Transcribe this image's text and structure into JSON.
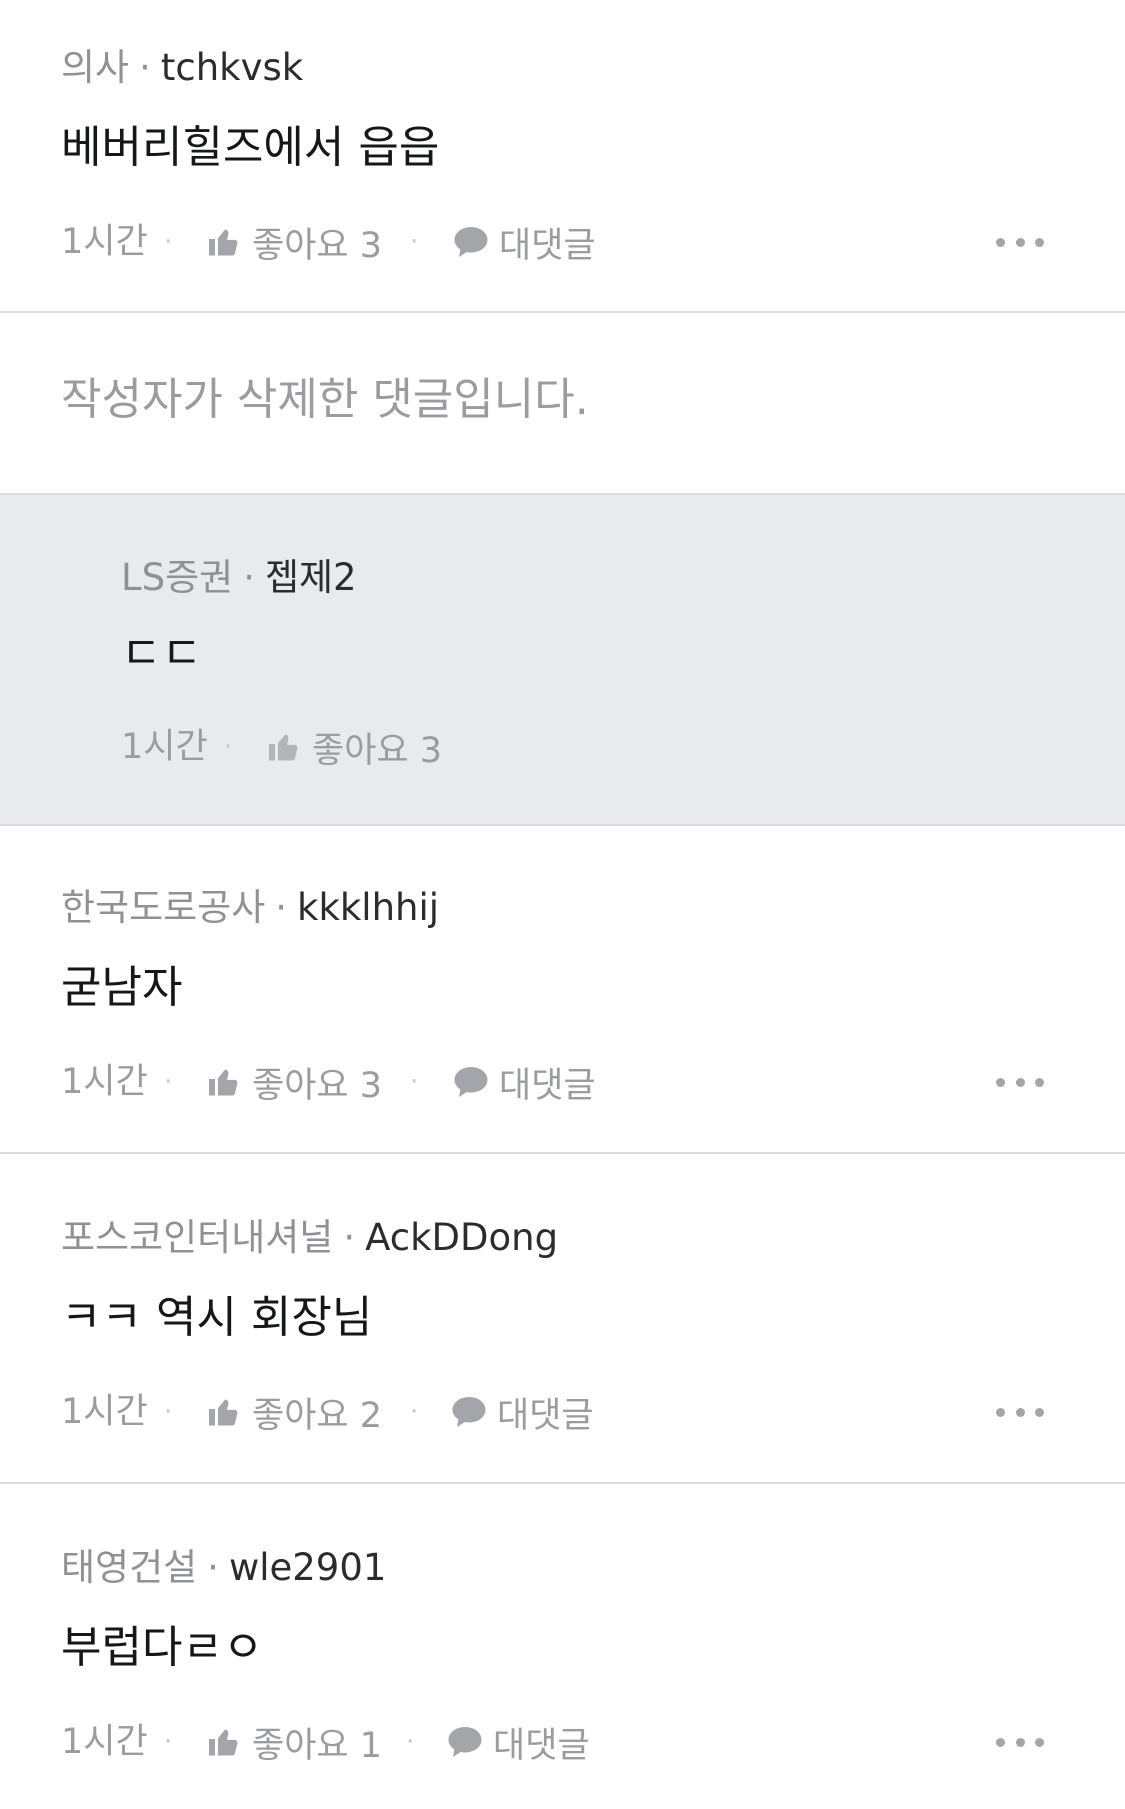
{
  "comments": [
    {
      "company": "의사",
      "nickname": "tchkvsk",
      "text": "베버리힐즈에서 읍읍",
      "time": "1시간",
      "like_label": "좋아요 3",
      "reply_label": "대댓글"
    },
    {
      "deleted_text": "작성자가 삭제한 댓글입니다."
    },
    {
      "company": "LS증권",
      "nickname": "젭제2",
      "text": "ㄷㄷ",
      "time": "1시간",
      "like_label": "좋아요 3"
    },
    {
      "company": "한국도로공사",
      "nickname": "kkklhhij",
      "text": "굳남자",
      "time": "1시간",
      "like_label": "좋아요 3",
      "reply_label": "대댓글"
    },
    {
      "company": "포스코인터내셔널",
      "nickname": "AckDDong",
      "text": "ㅋㅋ 역시 회장님",
      "time": "1시간",
      "like_label": "좋아요 2",
      "reply_label": "대댓글"
    },
    {
      "company": "태영건설",
      "nickname": "wle2901",
      "text": "부럽다ㄹㅇ",
      "time": "1시간",
      "like_label": "좋아요 1",
      "reply_label": "대댓글"
    }
  ],
  "separator": "·",
  "icons": {
    "like": "thumbs-up-icon",
    "reply": "speech-bubble-icon",
    "more": "more-options-icon"
  },
  "colors": {
    "meta_gray": "#8f9197",
    "text_dark": "#16171a",
    "reply_bg": "#e9eaed",
    "divider": "#dcdde0"
  }
}
